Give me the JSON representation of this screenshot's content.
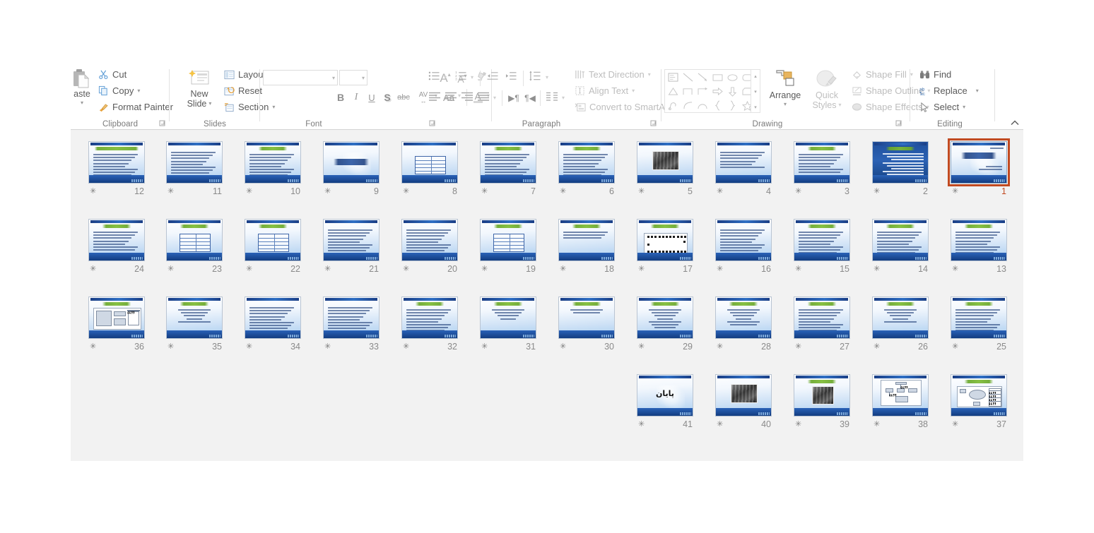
{
  "app": {
    "name": "PowerPoint Slide Sorter"
  },
  "ribbon": {
    "collapse_icon": "chevron-up-icon",
    "groups": [
      {
        "key": "clipboard",
        "label": "Clipboard"
      },
      {
        "key": "slides",
        "label": "Slides"
      },
      {
        "key": "font",
        "label": "Font"
      },
      {
        "key": "paragraph",
        "label": "Paragraph"
      },
      {
        "key": "drawing",
        "label": "Drawing"
      },
      {
        "key": "editing",
        "label": "Editing"
      }
    ],
    "clipboard": {
      "paste_label": "aste",
      "paste_caret": "▾",
      "cut_label": "Cut",
      "copy_label": "Copy",
      "copy_caret": "▾",
      "format_painter_label": "Format Painter"
    },
    "slides": {
      "new_slide_line1": "New",
      "new_slide_line2": "Slide",
      "new_slide_caret": "▾",
      "layout_label": "Layout",
      "layout_caret": "▾",
      "reset_label": "Reset",
      "section_label": "Section",
      "section_caret": "▾"
    },
    "font": {
      "font_name_value": "",
      "font_name_caret": "▾",
      "font_size_value": "",
      "font_size_caret": "▾",
      "grow_font": "A",
      "shrink_font": "A",
      "clear_formatting": "clear-formatting-icon",
      "bold": "B",
      "italic": "I",
      "underline": "U",
      "shadow": "S",
      "strikethrough": "abc",
      "char_spacing": "AV",
      "char_spacing_caret": "▾",
      "change_case": "Aa",
      "change_case_caret": "▾",
      "font_color": "A",
      "font_color_caret": "▾"
    },
    "paragraph": {
      "bullets_caret": "▾",
      "numbering_caret": "▾",
      "line_spacing_caret": "▾",
      "align_caret": "▾",
      "columns_caret": "▾",
      "text_direction_label": "Text Direction",
      "text_direction_caret": "▾",
      "align_text_label": "Align Text",
      "align_text_caret": "▾",
      "convert_smartart_label": "Convert to SmartArt",
      "convert_smartart_caret": "▾"
    },
    "drawing": {
      "arrange_label": "Arrange",
      "arrange_caret": "▾",
      "quick_styles_line1": "Quick",
      "quick_styles_line2": "Styles",
      "quick_styles_caret": "▾",
      "shape_fill_label": "Shape Fill",
      "shape_fill_caret": "▾",
      "shape_outline_label": "Shape Outline",
      "shape_outline_caret": "▾",
      "shape_effects_label": "Shape Effects",
      "shape_effects_caret": "▾",
      "gallery_scroll_up": "▴",
      "gallery_scroll_down": "▾",
      "gallery_scroll_more": "▾"
    },
    "editing": {
      "find_label": "Find",
      "replace_label": "Replace",
      "replace_caret": "▾",
      "select_label": "Select",
      "select_caret": "▾"
    }
  },
  "sorter": {
    "star_glyph": "✳",
    "selected_slide": 1,
    "slides": [
      {
        "n": 12,
        "row": 0,
        "col": 0,
        "kind": "body",
        "title": "green",
        "lines": 10
      },
      {
        "n": 11,
        "row": 0,
        "col": 1,
        "kind": "body",
        "title": "none",
        "lines": 8
      },
      {
        "n": 10,
        "row": 0,
        "col": 2,
        "kind": "body",
        "title": "greenS",
        "lines": 9
      },
      {
        "n": 9,
        "row": 0,
        "col": 3,
        "kind": "section",
        "title": "none",
        "lines": 0
      },
      {
        "n": 8,
        "row": 0,
        "col": 4,
        "kind": "table",
        "title": "none",
        "lines": 0
      },
      {
        "n": 7,
        "row": 0,
        "col": 5,
        "kind": "body",
        "title": "greenS",
        "lines": 9
      },
      {
        "n": 6,
        "row": 0,
        "col": 6,
        "kind": "body",
        "title": "greenS",
        "lines": 10
      },
      {
        "n": 5,
        "row": 0,
        "col": 7,
        "kind": "photo",
        "title": "none",
        "lines": 0
      },
      {
        "n": 4,
        "row": 0,
        "col": 8,
        "kind": "body",
        "title": "none",
        "lines": 6
      },
      {
        "n": 3,
        "row": 0,
        "col": 9,
        "kind": "body",
        "title": "greenS",
        "lines": 7
      },
      {
        "n": 2,
        "row": 0,
        "col": 10,
        "kind": "dark-list",
        "title": "greenS",
        "lines": 8
      },
      {
        "n": 1,
        "row": 0,
        "col": 11,
        "kind": "title-slide",
        "title": "none",
        "lines": 0
      },
      {
        "n": 24,
        "row": 1,
        "col": 0,
        "kind": "body",
        "title": "greenS",
        "lines": 7
      },
      {
        "n": 23,
        "row": 1,
        "col": 1,
        "kind": "table",
        "title": "greenS",
        "lines": 0
      },
      {
        "n": 22,
        "row": 1,
        "col": 2,
        "kind": "table",
        "title": "greenS",
        "lines": 0
      },
      {
        "n": 21,
        "row": 1,
        "col": 3,
        "kind": "body",
        "title": "none",
        "lines": 8
      },
      {
        "n": 20,
        "row": 1,
        "col": 4,
        "kind": "body",
        "title": "none",
        "lines": 9
      },
      {
        "n": 19,
        "row": 1,
        "col": 5,
        "kind": "table",
        "title": "greenS",
        "lines": 0
      },
      {
        "n": 18,
        "row": 1,
        "col": 6,
        "kind": "body",
        "title": "greenS",
        "lines": 3
      },
      {
        "n": 17,
        "row": 1,
        "col": 7,
        "kind": "grid",
        "title": "greenS",
        "lines": 0
      },
      {
        "n": 16,
        "row": 1,
        "col": 8,
        "kind": "body",
        "title": "none",
        "lines": 10
      },
      {
        "n": 15,
        "row": 1,
        "col": 9,
        "kind": "body",
        "title": "greenS",
        "lines": 9
      },
      {
        "n": 14,
        "row": 1,
        "col": 10,
        "kind": "body",
        "title": "greenS",
        "lines": 9
      },
      {
        "n": 13,
        "row": 1,
        "col": 11,
        "kind": "body",
        "title": "greenS",
        "lines": 10
      },
      {
        "n": 36,
        "row": 2,
        "col": 0,
        "kind": "screenshot",
        "title": "greenS",
        "lines": 0
      },
      {
        "n": 35,
        "row": 2,
        "col": 1,
        "kind": "body-center",
        "title": "greenS",
        "lines": 5
      },
      {
        "n": 34,
        "row": 2,
        "col": 2,
        "kind": "body",
        "title": "none",
        "lines": 9
      },
      {
        "n": 33,
        "row": 2,
        "col": 3,
        "kind": "body",
        "title": "none",
        "lines": 9
      },
      {
        "n": 32,
        "row": 2,
        "col": 4,
        "kind": "body",
        "title": "greenS",
        "lines": 8
      },
      {
        "n": 31,
        "row": 2,
        "col": 5,
        "kind": "body-center",
        "title": "greenS",
        "lines": 4
      },
      {
        "n": 30,
        "row": 2,
        "col": 6,
        "kind": "body-center",
        "title": "greenS",
        "lines": 2
      },
      {
        "n": 29,
        "row": 2,
        "col": 7,
        "kind": "body-center",
        "title": "greenS",
        "lines": 7
      },
      {
        "n": 28,
        "row": 2,
        "col": 8,
        "kind": "body-center",
        "title": "greenS",
        "lines": 6
      },
      {
        "n": 27,
        "row": 2,
        "col": 9,
        "kind": "body",
        "title": "greenS",
        "lines": 8
      },
      {
        "n": 26,
        "row": 2,
        "col": 10,
        "kind": "body-center",
        "title": "greenS",
        "lines": 5
      },
      {
        "n": 25,
        "row": 2,
        "col": 11,
        "kind": "body",
        "title": "greenS",
        "lines": 9
      },
      {
        "n": 41,
        "row": 3,
        "col": 7,
        "kind": "end-slide",
        "title": "none",
        "lines": 0
      },
      {
        "n": 40,
        "row": 3,
        "col": 8,
        "kind": "photo",
        "title": "none",
        "lines": 0
      },
      {
        "n": 39,
        "row": 3,
        "col": 9,
        "kind": "photo-title",
        "title": "greenS",
        "lines": 0
      },
      {
        "n": 38,
        "row": 3,
        "col": 10,
        "kind": "diagram",
        "title": "none",
        "lines": 0
      },
      {
        "n": 37,
        "row": 3,
        "col": 11,
        "kind": "diagram2",
        "title": "greenS",
        "lines": 0
      }
    ]
  }
}
